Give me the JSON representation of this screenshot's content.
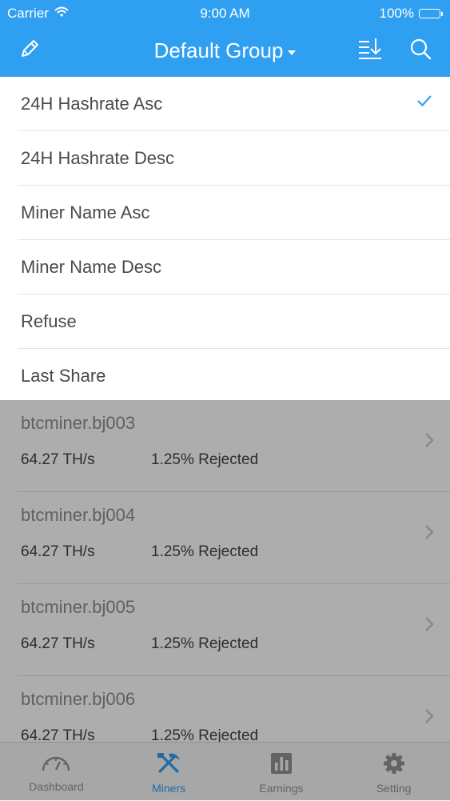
{
  "status_bar": {
    "carrier": "Carrier",
    "time": "9:00 AM",
    "battery": "100%"
  },
  "nav": {
    "title": "Default Group"
  },
  "sort_menu": {
    "options": [
      {
        "label": "24H Hashrate Asc",
        "selected": true
      },
      {
        "label": "24H Hashrate Desc",
        "selected": false
      },
      {
        "label": "Miner Name Asc",
        "selected": false
      },
      {
        "label": "Miner Name Desc",
        "selected": false
      },
      {
        "label": "Refuse",
        "selected": false
      },
      {
        "label": "Last Share",
        "selected": false
      }
    ]
  },
  "miners": [
    {
      "name": "btcminer.bj003",
      "hashrate": "64.27 TH/s",
      "rejected": "1.25% Rejected"
    },
    {
      "name": "btcminer.bj004",
      "hashrate": "64.27 TH/s",
      "rejected": "1.25% Rejected"
    },
    {
      "name": "btcminer.bj005",
      "hashrate": "64.27 TH/s",
      "rejected": "1.25% Rejected"
    },
    {
      "name": "btcminer.bj006",
      "hashrate": "64.27 TH/s",
      "rejected": "1.25% Rejected"
    }
  ],
  "tabs": [
    {
      "label": "Dashboard",
      "icon": "dashboard-icon",
      "active": false
    },
    {
      "label": "Miners",
      "icon": "miners-icon",
      "active": true
    },
    {
      "label": "Earnings",
      "icon": "earnings-icon",
      "active": false
    },
    {
      "label": "Setting",
      "icon": "setting-icon",
      "active": false
    }
  ],
  "colors": {
    "accent": "#2f9ff2",
    "tab_inactive": "#929292"
  }
}
